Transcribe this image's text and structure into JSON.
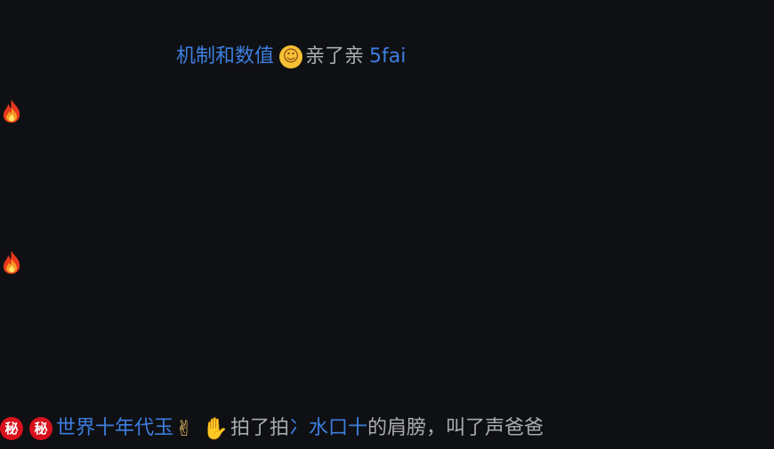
{
  "line1": {
    "user": "机制和数值",
    "emoji": "kiss-face-icon",
    "emoji_glyph": "☺",
    "action": "亲了亲",
    "target": "5fai"
  },
  "fire_icons": [
    {
      "icon": "fire-icon"
    },
    {
      "icon": "fire-icon"
    }
  ],
  "line2": {
    "badges": [
      "秘",
      "秘"
    ],
    "user": "世界十年代玉",
    "victory_emoji": "✌",
    "wave_emoji": "✋",
    "action": "拍了拍",
    "target": "冫水口十",
    "suffix": "的肩膀，叫了声爸爸"
  },
  "colors": {
    "background": "#0f1013",
    "username": "#3d7ee0",
    "action_text": "#a9abb2",
    "badge_red": "#d8121c"
  }
}
